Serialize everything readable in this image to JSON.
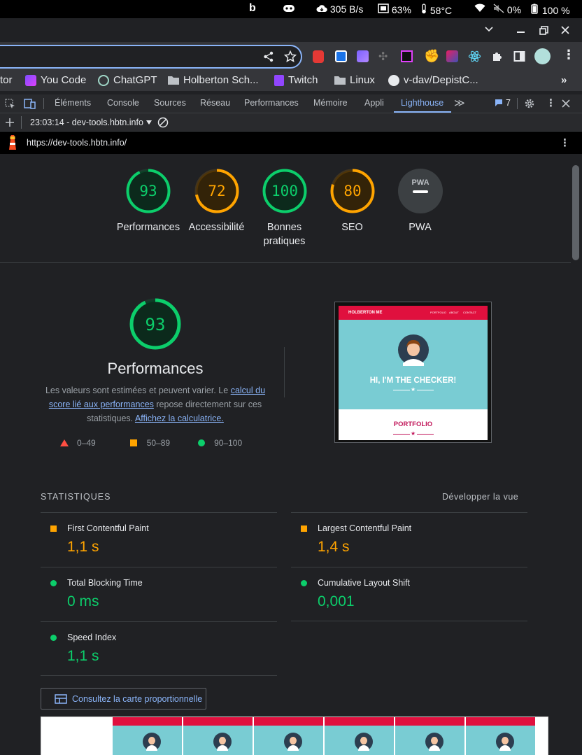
{
  "system": {
    "net_speed": "305 B/s",
    "ram": "63%",
    "temp": "58°C",
    "volume": "0%",
    "battery": "100 %"
  },
  "bookmarks": [
    {
      "label": "tor"
    },
    {
      "label": "You Code"
    },
    {
      "label": "ChatGPT"
    },
    {
      "label": "Holberton Sch..."
    },
    {
      "label": "Twitch"
    },
    {
      "label": "Linux"
    },
    {
      "label": "v-dav/DepistC..."
    }
  ],
  "devtools": {
    "tabs": [
      "Éléments",
      "Console",
      "Sources",
      "Réseau",
      "Performances",
      "Mémoire",
      "Appli",
      "Lighthouse"
    ],
    "active_tab": "Lighthouse",
    "issues_count": "7",
    "report_select": "23:03:14 - dev-tools.hbtn.info",
    "url": "https://dev-tools.hbtn.info/"
  },
  "gauges": [
    {
      "score": "93",
      "label": "Performances",
      "fraction": 0.93,
      "color": "#0cce6b"
    },
    {
      "score": "72",
      "label": "Accessibilité",
      "fraction": 0.72,
      "color": "#ffa400"
    },
    {
      "score": "100",
      "label": "Bonnes pratiques",
      "fraction": 1.0,
      "color": "#0cce6b"
    },
    {
      "score": "80",
      "label": "SEO",
      "fraction": 0.8,
      "color": "#ffa400"
    },
    {
      "score": "PWA",
      "label": "PWA"
    }
  ],
  "perf": {
    "score": "93",
    "fraction": 0.93,
    "title": "Performances",
    "desc_1": "Les valeurs sont estimées et peuvent varier. Le ",
    "link_1": "calcul du score lié aux performances",
    "desc_2": " repose directement sur ces statistiques. ",
    "link_2": "Affichez la calculatrice.",
    "legend": [
      "0–49",
      "50–89",
      "90–100"
    ]
  },
  "preview": {
    "brand": "HOLBERTON ME",
    "nav": [
      "PORTFOLIO",
      "ABOUT",
      "CONTACT"
    ],
    "hero": "HI, I'M THE CHECKER!",
    "section": "PORTFOLIO"
  },
  "stats": {
    "heading": "STATISTIQUES",
    "expand": "Développer la vue",
    "items": [
      {
        "label": "First Contentful Paint",
        "value": "1,1 s",
        "rating": "average"
      },
      {
        "label": "Largest Contentful Paint",
        "value": "1,4 s",
        "rating": "average"
      },
      {
        "label": "Total Blocking Time",
        "value": "0 ms",
        "rating": "pass"
      },
      {
        "label": "Cumulative Layout Shift",
        "value": "0,001",
        "rating": "pass"
      },
      {
        "label": "Speed Index",
        "value": "1,1 s",
        "rating": "pass"
      }
    ]
  },
  "treemap_button": "Consultez la carte proportionnelle",
  "colors": {
    "pass": "#0cce6b",
    "average": "#ffa400",
    "fail": "#ff4e42",
    "link": "#8ab4f8"
  }
}
